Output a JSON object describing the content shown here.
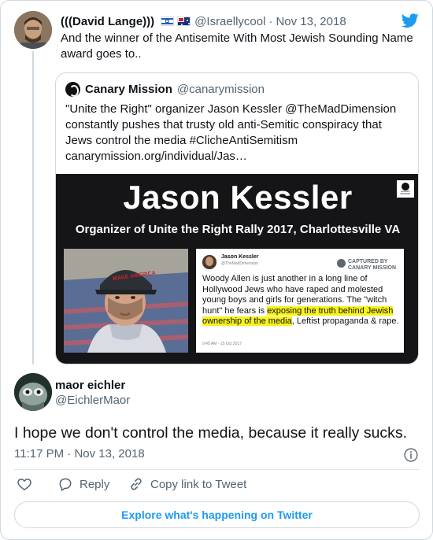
{
  "parent_tweet": {
    "name": "(((David Lange)))",
    "handle": "@Israellycool",
    "date": "Nov 13, 2018",
    "text": "And the winner of the Antisemite With Most Jewish Sounding Name award goes to.."
  },
  "quoted_tweet": {
    "name": "Canary Mission",
    "handle": "@canarymission",
    "text": "\"Unite the Right\" organizer Jason Kessler @TheMadDimension constantly pushes that trusty old anti-Semitic conspiracy that Jews control the media #ClicheAntiSemitism canarymission.org/individual/Jas…",
    "media": {
      "headline": "Jason Kessler",
      "subheadline": "Organizer of Unite the Right Rally 2017, Charlottesville VA",
      "badge_text": "CANARY MISSION",
      "card": {
        "name": "Jason Kessler",
        "handle": "@TheMadDimension",
        "captured_label": "CAPTURED BY CANARY MISSION",
        "text_before": "Woody Allen is just another in a long line of Hollywood Jews who have raped and molested young boys and girls for generations. The \"witch hunt\" he fears is ",
        "text_highlight": "exposing the truth behind Jewish ownership of the media",
        "text_after": ", Leftist propaganda & rape.",
        "time": "9:45 AM - 15 Oct 2017"
      }
    }
  },
  "main_tweet": {
    "name": "maor eichler",
    "handle": "@EichlerMaor",
    "text": "I hope we don't control the media, because it really sucks.",
    "time": "11:17 PM",
    "date": "Nov 13, 2018"
  },
  "actions": {
    "like_icon": "heart-icon",
    "reply_label": "Reply",
    "copy_label": "Copy link to Tweet"
  },
  "explore_label": "Explore what's happening on Twitter",
  "colors": {
    "twitter_blue": "#1d9bf0",
    "secondary_text": "#536471",
    "border": "#cfd9de",
    "highlight": "#f7f31b"
  }
}
